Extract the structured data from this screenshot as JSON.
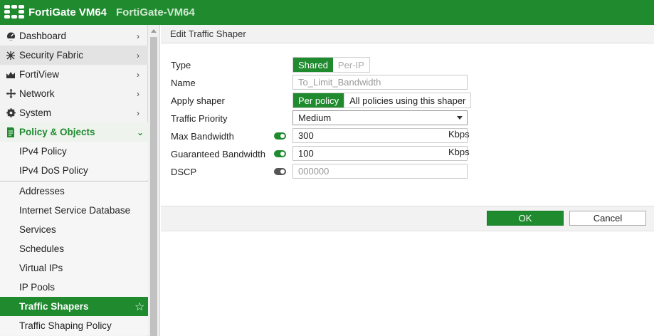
{
  "header": {
    "product": "FortiGate VM64",
    "hostname": "FortiGate-VM64"
  },
  "sidebar": {
    "items": [
      {
        "label": "Dashboard",
        "icon": "dashboard-icon"
      },
      {
        "label": "Security Fabric",
        "icon": "security-fabric-icon"
      },
      {
        "label": "FortiView",
        "icon": "fortiview-icon"
      },
      {
        "label": "Network",
        "icon": "network-icon"
      },
      {
        "label": "System",
        "icon": "gear-icon"
      },
      {
        "label": "Policy & Objects",
        "icon": "policy-icon"
      }
    ],
    "subitems": [
      "IPv4 Policy",
      "IPv4 DoS Policy",
      "Addresses",
      "Internet Service Database",
      "Services",
      "Schedules",
      "Virtual IPs",
      "IP Pools",
      "Traffic Shapers",
      "Traffic Shaping Policy"
    ],
    "active_subitem": "Traffic Shapers"
  },
  "panel": {
    "title": "Edit Traffic Shaper"
  },
  "form": {
    "type": {
      "label": "Type",
      "options": [
        "Shared",
        "Per-IP"
      ],
      "selected": "Shared"
    },
    "name": {
      "label": "Name",
      "placeholder": "To_Limit_Bandwidth"
    },
    "apply_shaper": {
      "label": "Apply shaper",
      "options": [
        "Per policy",
        "All policies using this shaper"
      ],
      "selected": "Per policy"
    },
    "traffic_priority": {
      "label": "Traffic Priority",
      "value": "Medium"
    },
    "max_bandwidth": {
      "label": "Max Bandwidth",
      "enabled": true,
      "value": "300",
      "unit": "Kbps"
    },
    "guaranteed_bandwidth": {
      "label": "Guaranteed Bandwidth",
      "enabled": true,
      "value": "100",
      "unit": "Kbps"
    },
    "dscp": {
      "label": "DSCP",
      "enabled": false,
      "placeholder": "000000"
    }
  },
  "buttons": {
    "ok": "OK",
    "cancel": "Cancel"
  },
  "colors": {
    "brand_green": "#1f8a2e"
  }
}
